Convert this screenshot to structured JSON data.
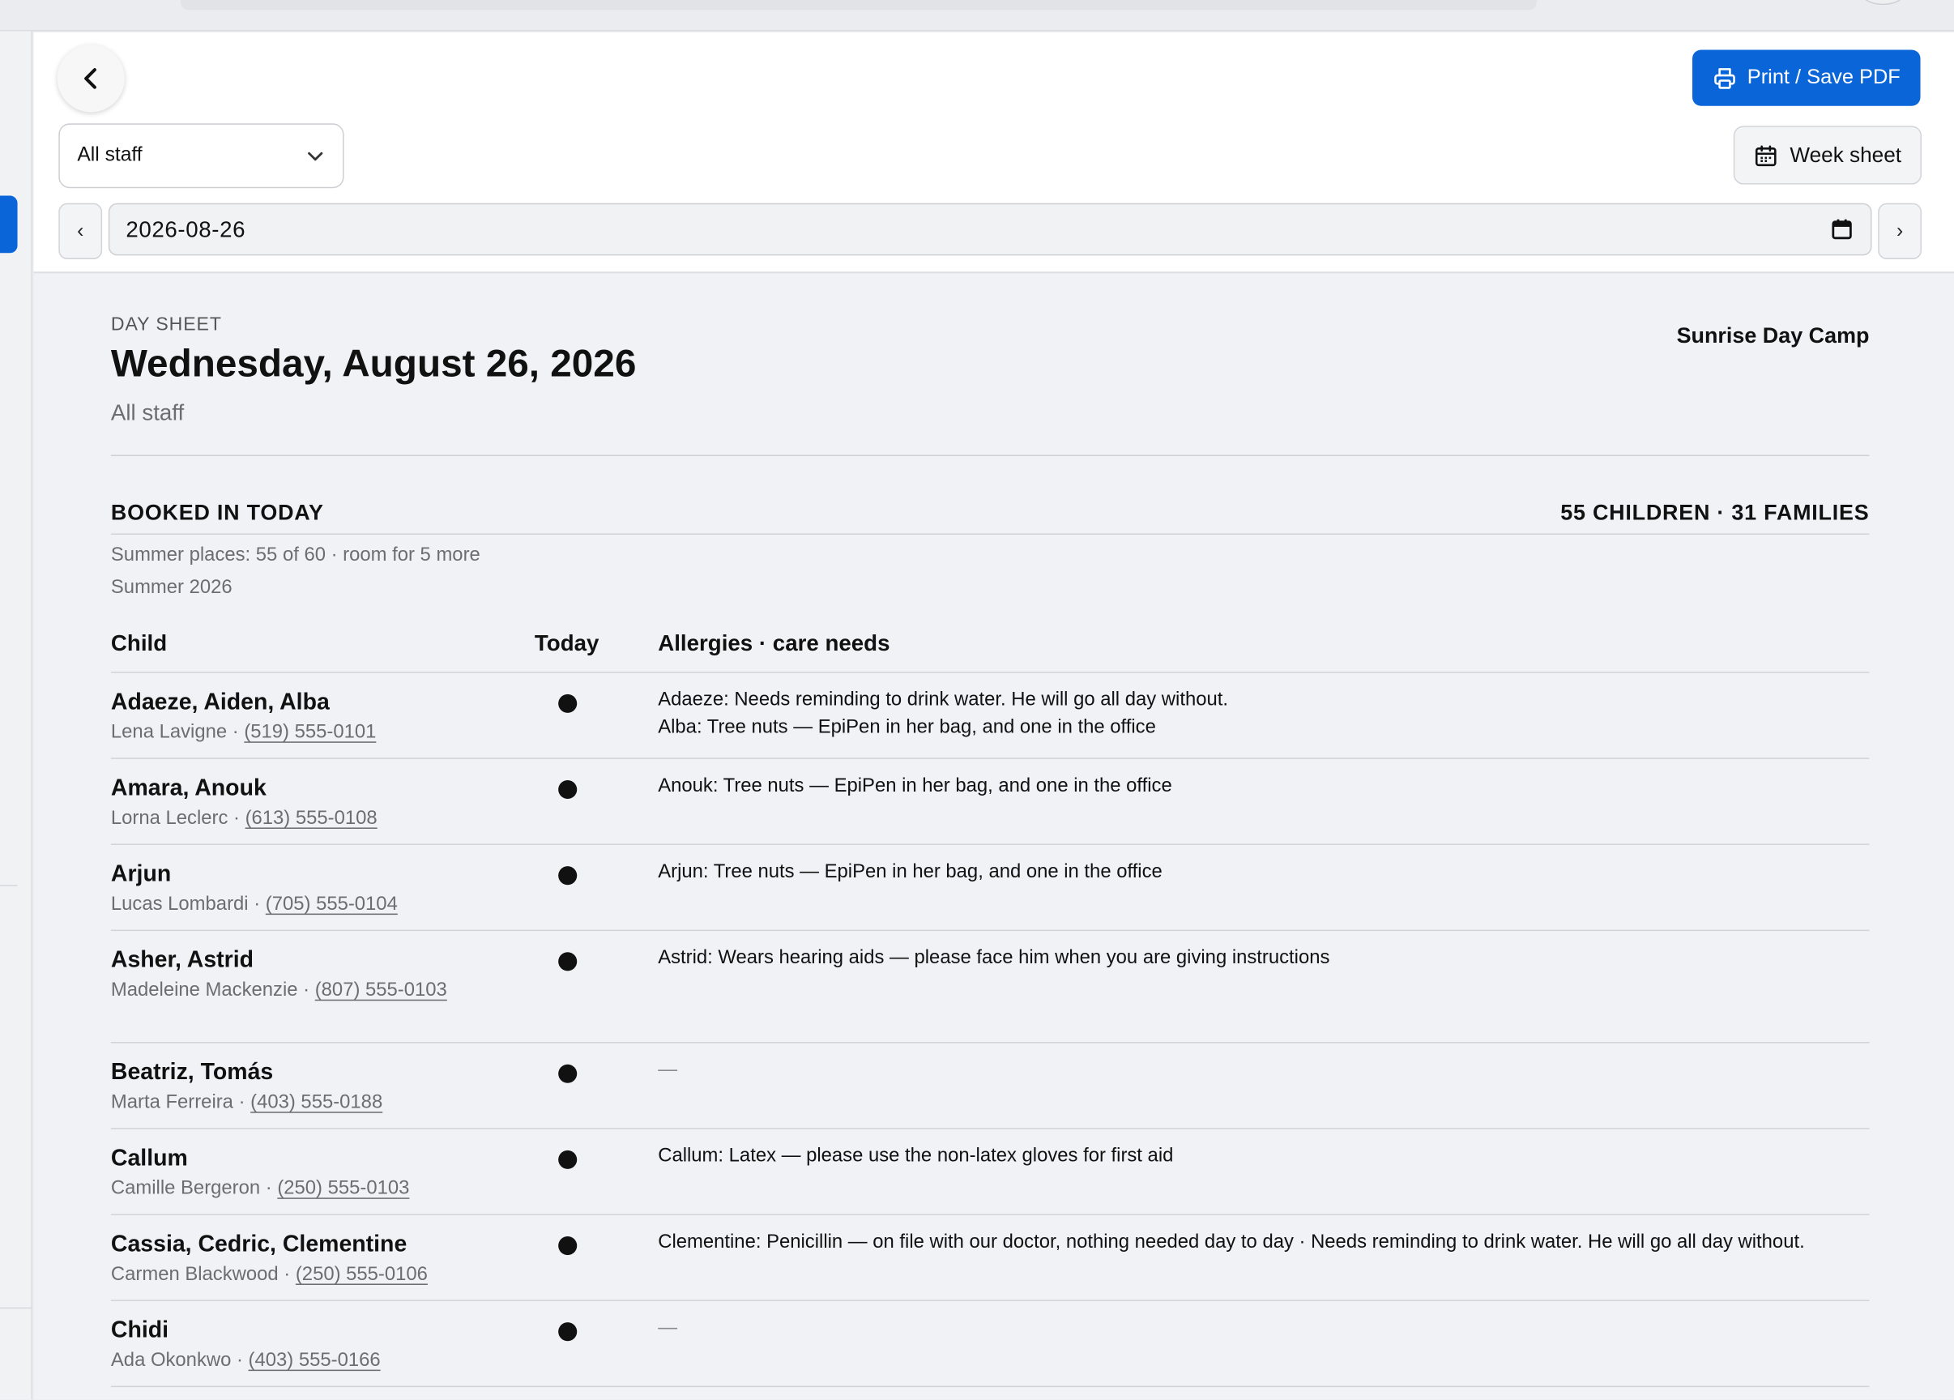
{
  "toolbar": {
    "print_label": "Print / Save PDF",
    "staff_select_value": "All staff",
    "week_sheet_label": "Week sheet",
    "prev_label": "‹",
    "next_label": "›",
    "date_value": "2026-08-26"
  },
  "sheet": {
    "kicker": "DAY SHEET",
    "title": "Wednesday, August 26, 2026",
    "subtitle": "All staff",
    "organization": "Sunrise Day Camp",
    "section_title": "BOOKED IN TODAY",
    "counts": "55 CHILDREN · 31 FAMILIES",
    "capacity": "Summer places: 55 of 60 · room for 5 more",
    "season": "Summer 2026",
    "columns": [
      "Child",
      "Today",
      "Allergies · care needs"
    ]
  },
  "rows": [
    {
      "names": "Adaeze, Aiden, Alba",
      "guardian": "Lena Lavigne",
      "phone": "(519) 555-0101",
      "notes": [
        "Adaeze: Needs reminding to drink water. He will go all day without.",
        "Alba: Tree nuts — EpiPen in her bag, and one in the office"
      ]
    },
    {
      "names": "Amara, Anouk",
      "guardian": "Lorna Leclerc",
      "phone": "(613) 555-0108",
      "notes": [
        "Anouk: Tree nuts — EpiPen in her bag, and one in the office"
      ]
    },
    {
      "names": "Arjun",
      "guardian": "Lucas Lombardi",
      "phone": "(705) 555-0104",
      "notes": [
        "Arjun: Tree nuts — EpiPen in her bag, and one in the office"
      ]
    },
    {
      "names": "Asher, Astrid",
      "guardian": "Madeleine Mackenzie",
      "phone": "(807) 555-0103",
      "notes": [
        "Astrid: Wears hearing aids — please face him when you are giving instructions"
      ]
    },
    {
      "names": "Beatriz, Tomás",
      "guardian": "Marta Ferreira",
      "phone": "(403) 555-0188",
      "notes": [
        "—"
      ]
    },
    {
      "names": "Callum",
      "guardian": "Camille Bergeron",
      "phone": "(250) 555-0103",
      "notes": [
        "Callum: Latex — please use the non-latex gloves for first aid"
      ]
    },
    {
      "names": "Cassia, Cedric, Clementine",
      "guardian": "Carmen Blackwood",
      "phone": "(250) 555-0106",
      "notes": [
        "Clementine: Penicillin — on file with our doctor, nothing needed day to day · Needs reminding to drink water. He will go all day without."
      ]
    },
    {
      "names": "Chidi",
      "guardian": "Ada Okonkwo",
      "phone": "(403) 555-0166",
      "notes": [
        "—"
      ]
    }
  ]
}
